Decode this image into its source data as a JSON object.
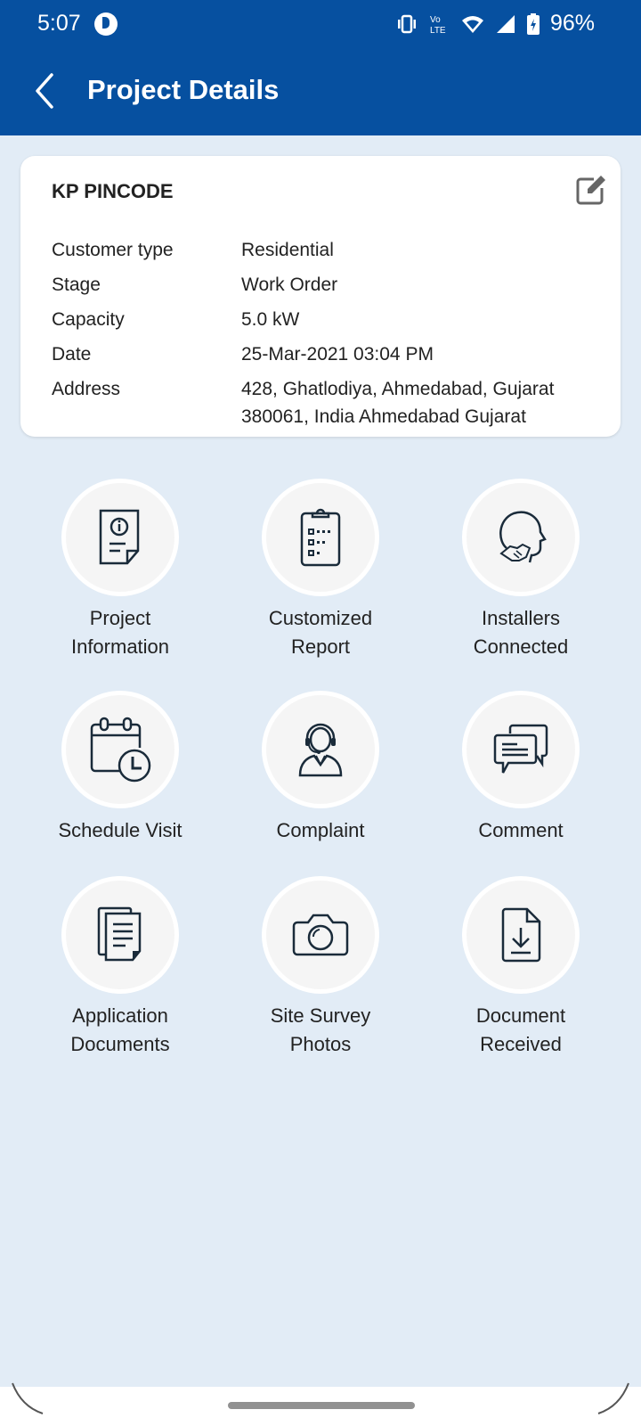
{
  "status_bar": {
    "time": "5:07",
    "battery_percent": "96%",
    "icons": [
      "vibrate-icon",
      "volte-icon",
      "wifi-icon",
      "signal-icon",
      "battery-charging-icon"
    ]
  },
  "header": {
    "title": "Project Details",
    "back_icon": "back-arrow-icon"
  },
  "project_card": {
    "title": "KP PINCODE",
    "edit_icon": "edit-icon",
    "fields": [
      {
        "label": "Customer type",
        "value": "Residential"
      },
      {
        "label": "Stage",
        "value": "Work Order"
      },
      {
        "label": "Capacity",
        "value": "5.0 kW"
      },
      {
        "label": "Date",
        "value": "25-Mar-2021 03:04 PM"
      },
      {
        "label": "Address",
        "value": "428, Ghatlodiya, Ahmedabad, Gujarat 380061, India Ahmedabad Gujarat"
      }
    ]
  },
  "menu": [
    {
      "label": "Project\nInformation",
      "icon": "document-info-icon"
    },
    {
      "label": "Customized\nReport",
      "icon": "clipboard-checklist-icon"
    },
    {
      "label": "Installers\nConnected",
      "icon": "handshake-head-icon"
    },
    {
      "label": "Schedule Visit",
      "icon": "calendar-clock-icon"
    },
    {
      "label": "Complaint",
      "icon": "support-agent-icon"
    },
    {
      "label": "Comment",
      "icon": "chat-bubbles-icon"
    },
    {
      "label": "Application\nDocuments",
      "icon": "documents-icon"
    },
    {
      "label": "Site Survey\nPhotos",
      "icon": "camera-icon"
    },
    {
      "label": "Document\nReceived",
      "icon": "document-download-icon"
    }
  ]
}
